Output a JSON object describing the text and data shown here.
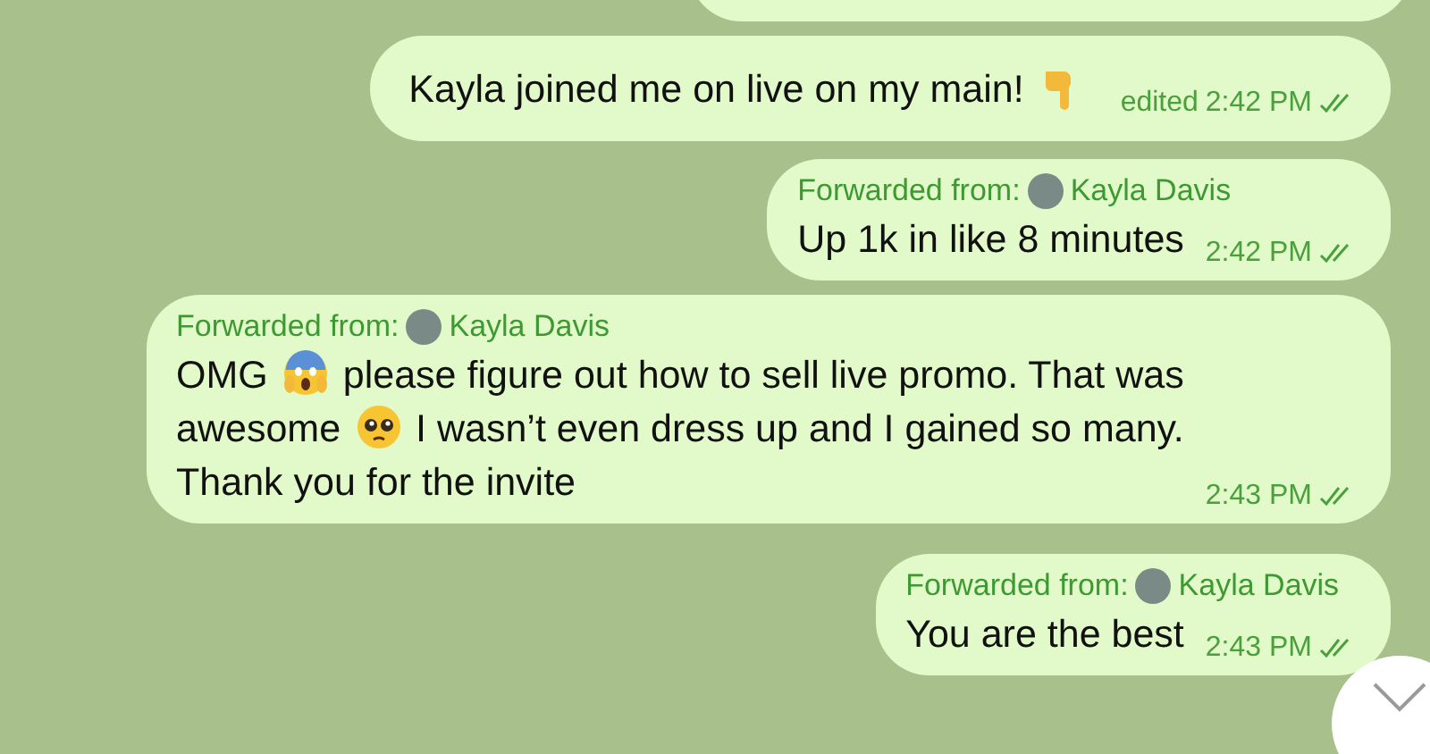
{
  "messages": [
    {
      "kind": "partial"
    },
    {
      "kind": "plain",
      "lines": [
        [
          {
            "kind": "text",
            "text": "Kayla joined me on live on my main!"
          },
          {
            "kind": "hand-emoji"
          }
        ]
      ],
      "edited": "edited",
      "time": "2:42 PM",
      "read": true
    },
    {
      "kind": "forwarded",
      "forwarded_label": "Forwarded from:",
      "sender": "Kayla Davis",
      "lines": [
        [
          {
            "kind": "text",
            "text": "Up 1k in like 8 minutes"
          }
        ]
      ],
      "time": "2:42 PM",
      "read": true
    },
    {
      "kind": "forwarded",
      "forwarded_label": "Forwarded from:",
      "sender": "Kayla Davis",
      "lines": [
        [
          {
            "kind": "text",
            "text": "OMG"
          },
          {
            "kind": "shocked-emoji"
          },
          {
            "kind": "text",
            "text": "please figure out how to sell live promo. That was"
          }
        ],
        [
          {
            "kind": "text",
            "text": "awesome"
          },
          {
            "kind": "pleading-emoji"
          },
          {
            "kind": "text",
            "text": "I wasn’t even dress up and I gained so many."
          }
        ],
        [
          {
            "kind": "text",
            "text": "Thank you for the invite"
          }
        ]
      ],
      "time": "2:43 PM",
      "read": true
    },
    {
      "kind": "forwarded",
      "forwarded_label": "Forwarded from:",
      "sender": "Kayla Davis",
      "lines": [
        [
          {
            "kind": "text",
            "text": "You are the best"
          }
        ]
      ],
      "time": "2:43 PM",
      "read": true
    }
  ]
}
